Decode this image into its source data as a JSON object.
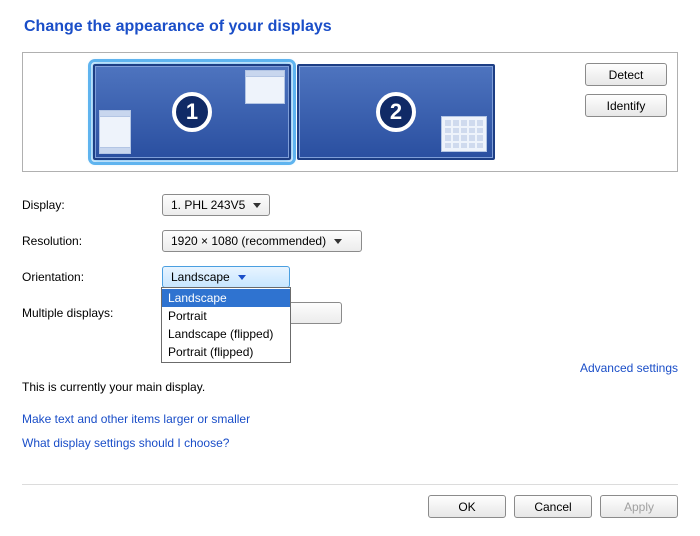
{
  "title": "Change the appearance of your displays",
  "buttons": {
    "detect": "Detect",
    "identify": "Identify",
    "ok": "OK",
    "cancel": "Cancel",
    "apply": "Apply"
  },
  "monitors": {
    "m1": "1",
    "m2": "2"
  },
  "labels": {
    "display": "Display:",
    "resolution": "Resolution:",
    "orientation": "Orientation:",
    "multiple": "Multiple displays:"
  },
  "values": {
    "display": "1. PHL 243V5",
    "resolution": "1920 × 1080 (recommended)",
    "orientation": "Landscape",
    "multiple": ""
  },
  "orientation_options": {
    "o0": "Landscape",
    "o1": "Portrait",
    "o2": "Landscape (flipped)",
    "o3": "Portrait (flipped)"
  },
  "main_display_text": "This is currently your main display.",
  "links": {
    "advanced": "Advanced settings",
    "text_size": "Make text and other items larger or smaller",
    "help": "What display settings should I choose?"
  }
}
